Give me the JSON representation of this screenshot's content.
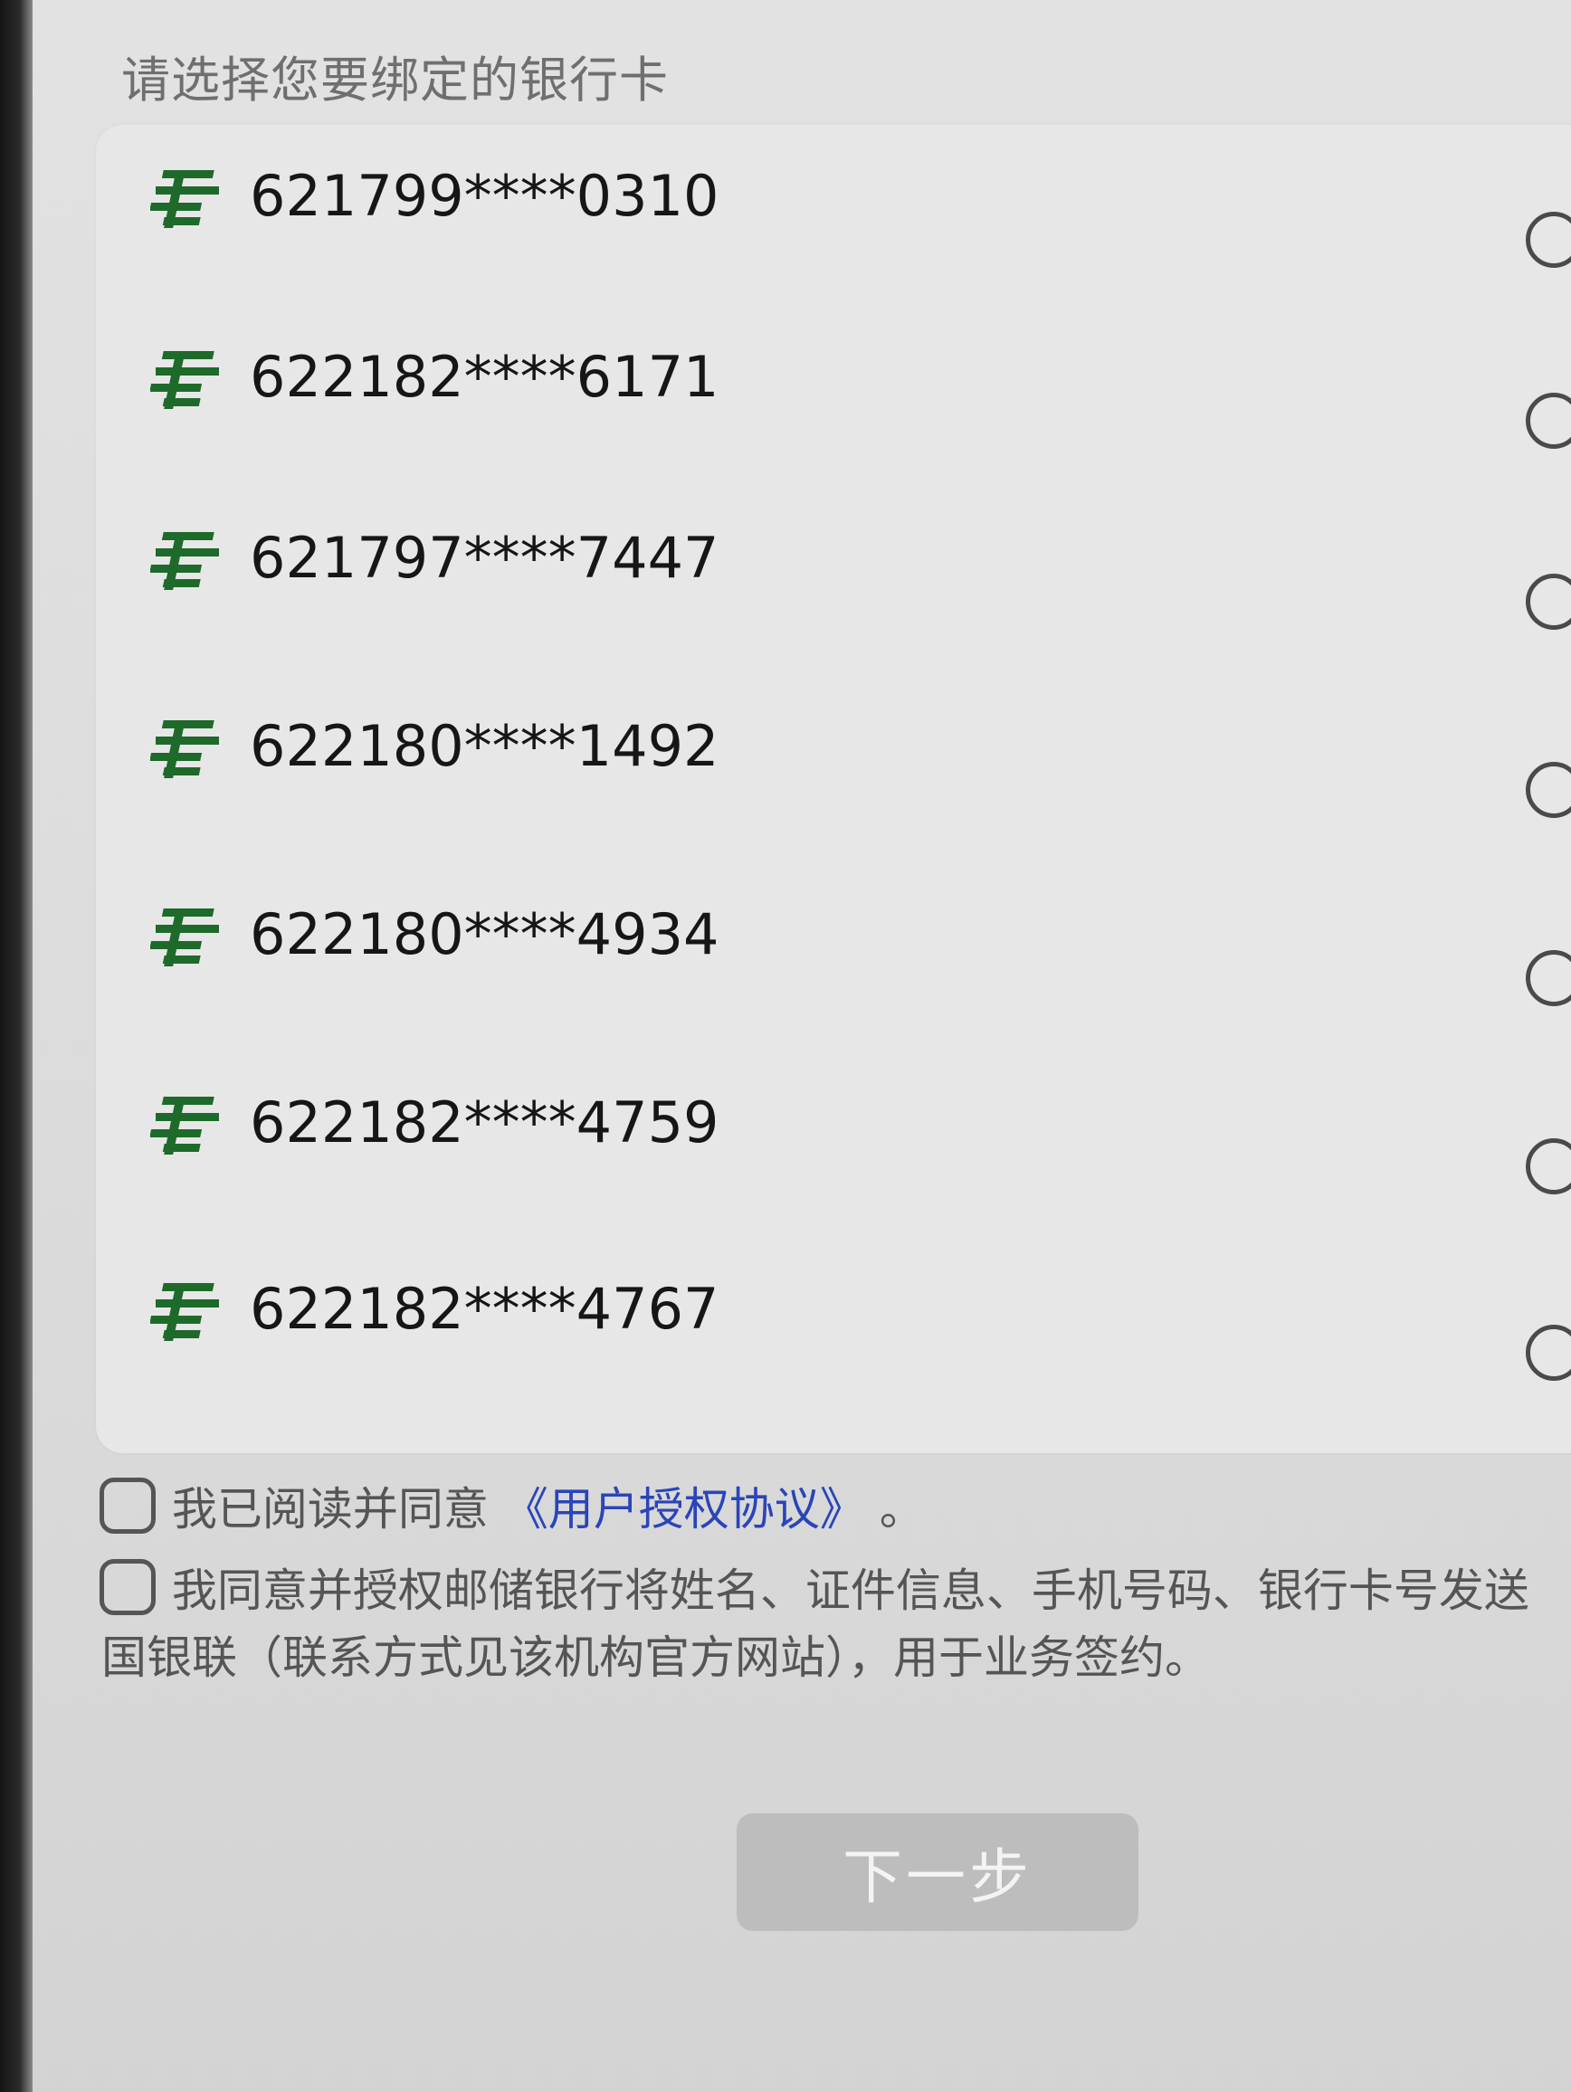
{
  "section_title": "请选择您要绑定的银行卡",
  "bank_icon_color": "#1e6a2a",
  "cards": [
    {
      "number": "621799****0310"
    },
    {
      "number": "622182****6171"
    },
    {
      "number": "621797****7447"
    },
    {
      "number": "622180****1492"
    },
    {
      "number": "622180****4934"
    },
    {
      "number": "622182****4759"
    },
    {
      "number": "622182****4767"
    }
  ],
  "agreement": {
    "prefix": "我已阅读并同意",
    "link": "《用户授权协议》",
    "suffix": "。"
  },
  "consent": {
    "line1": "我同意并授权邮储银行将姓名、证件信息、手机号码、银行卡号发送",
    "line2": "国银联（联系方式见该机构官方网站），用于业务签约。"
  },
  "next_button": {
    "label": "下一步"
  }
}
